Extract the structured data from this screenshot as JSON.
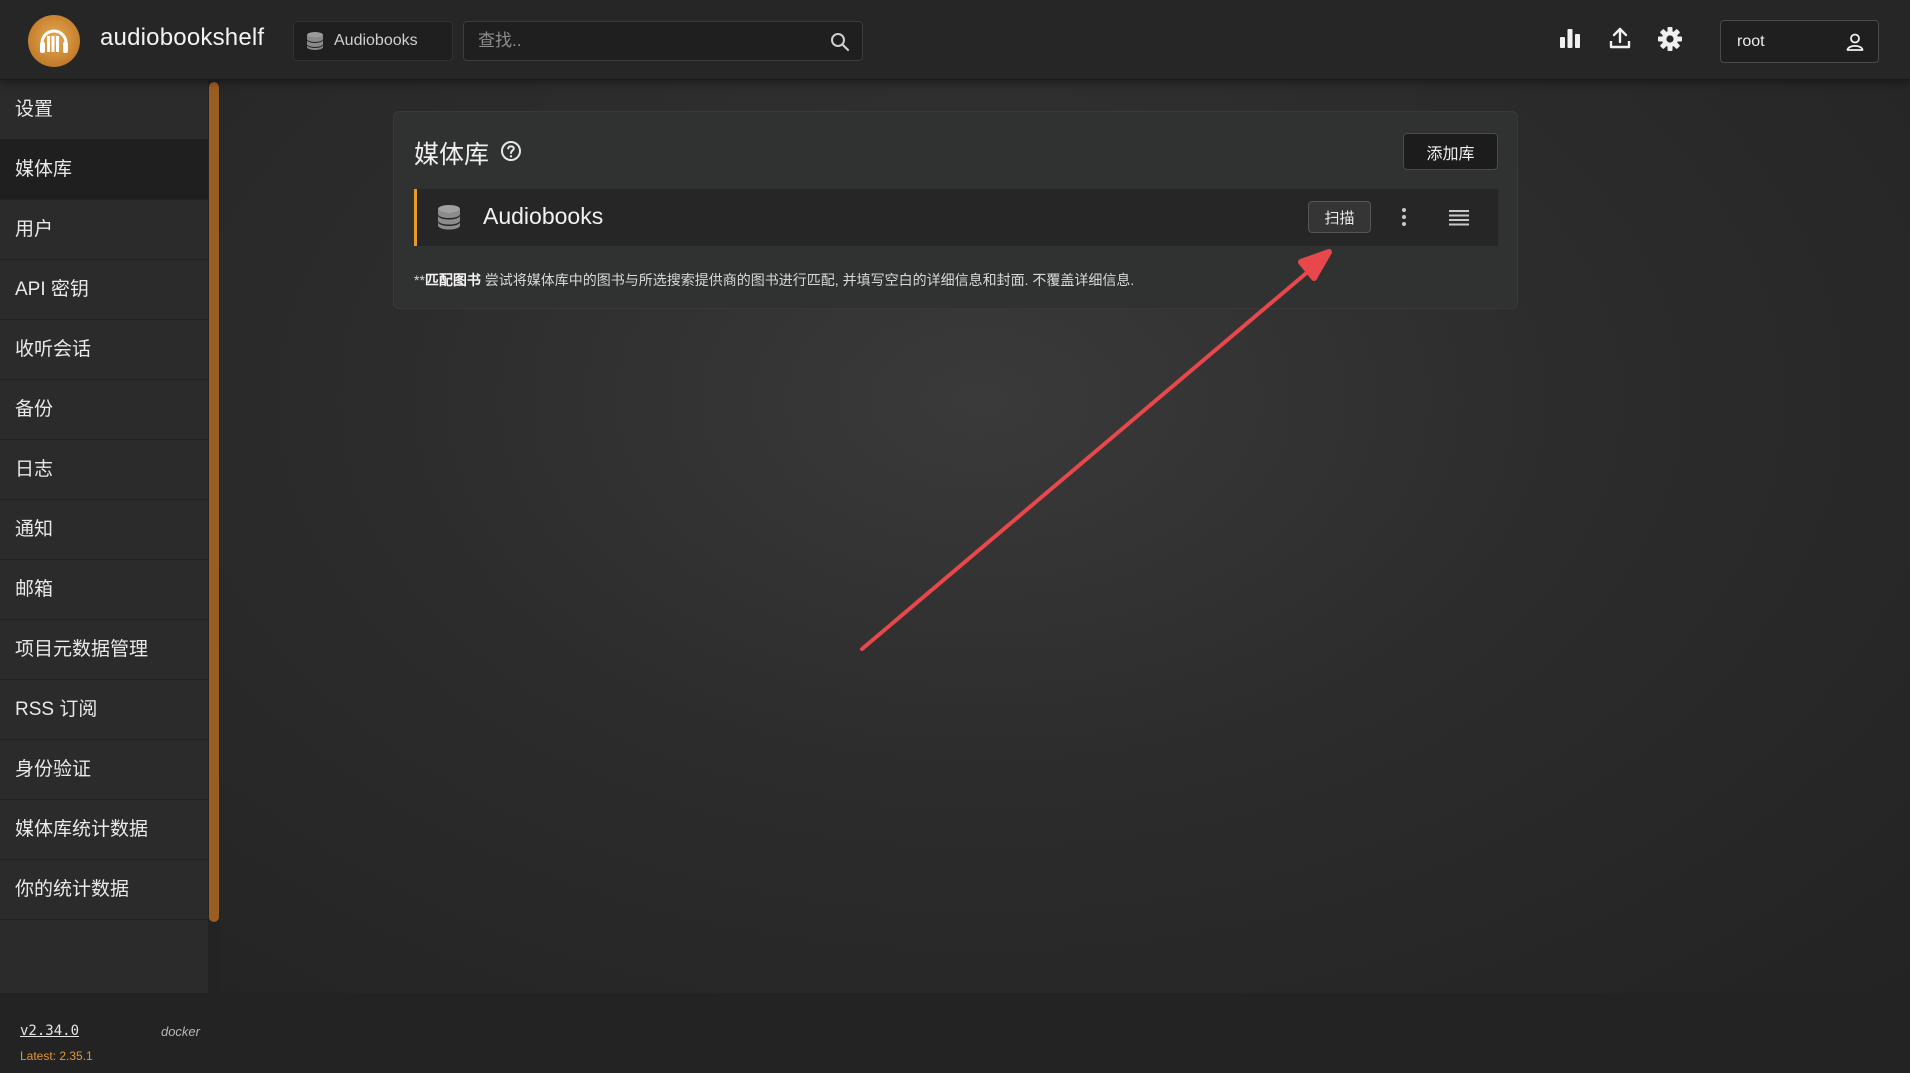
{
  "header": {
    "app_title": "audiobookshelf",
    "library_selector": "Audiobooks",
    "search_placeholder": "查找..",
    "user": "root"
  },
  "sidebar": {
    "items": [
      {
        "label": "设置"
      },
      {
        "label": "媒体库",
        "active": true
      },
      {
        "label": "用户"
      },
      {
        "label": "API 密钥"
      },
      {
        "label": "收听会话"
      },
      {
        "label": "备份"
      },
      {
        "label": "日志"
      },
      {
        "label": "通知"
      },
      {
        "label": "邮箱"
      },
      {
        "label": "项目元数据管理"
      },
      {
        "label": "RSS 订阅"
      },
      {
        "label": "身份验证"
      },
      {
        "label": "媒体库统计数据"
      },
      {
        "label": "你的统计数据"
      }
    ],
    "version": "v2.34.0",
    "platform": "docker",
    "latest": "Latest: 2.35.1"
  },
  "libraries_panel": {
    "title": "媒体库",
    "add_button": "添加库",
    "library": {
      "name": "Audiobooks",
      "scan_button": "扫描"
    },
    "hint_prefix": "**",
    "hint_bold": "匹配图书",
    "hint_text": " 尝试将媒体库中的图书与所选搜索提供商的图书进行匹配, 并填写空白的详细信息和封面. 不覆盖详细信息."
  },
  "colors": {
    "accent": "#e89a2b",
    "scrollbar": "#9b5e22",
    "annotation_arrow": "#e8474b",
    "latest_version": "#e39535"
  }
}
